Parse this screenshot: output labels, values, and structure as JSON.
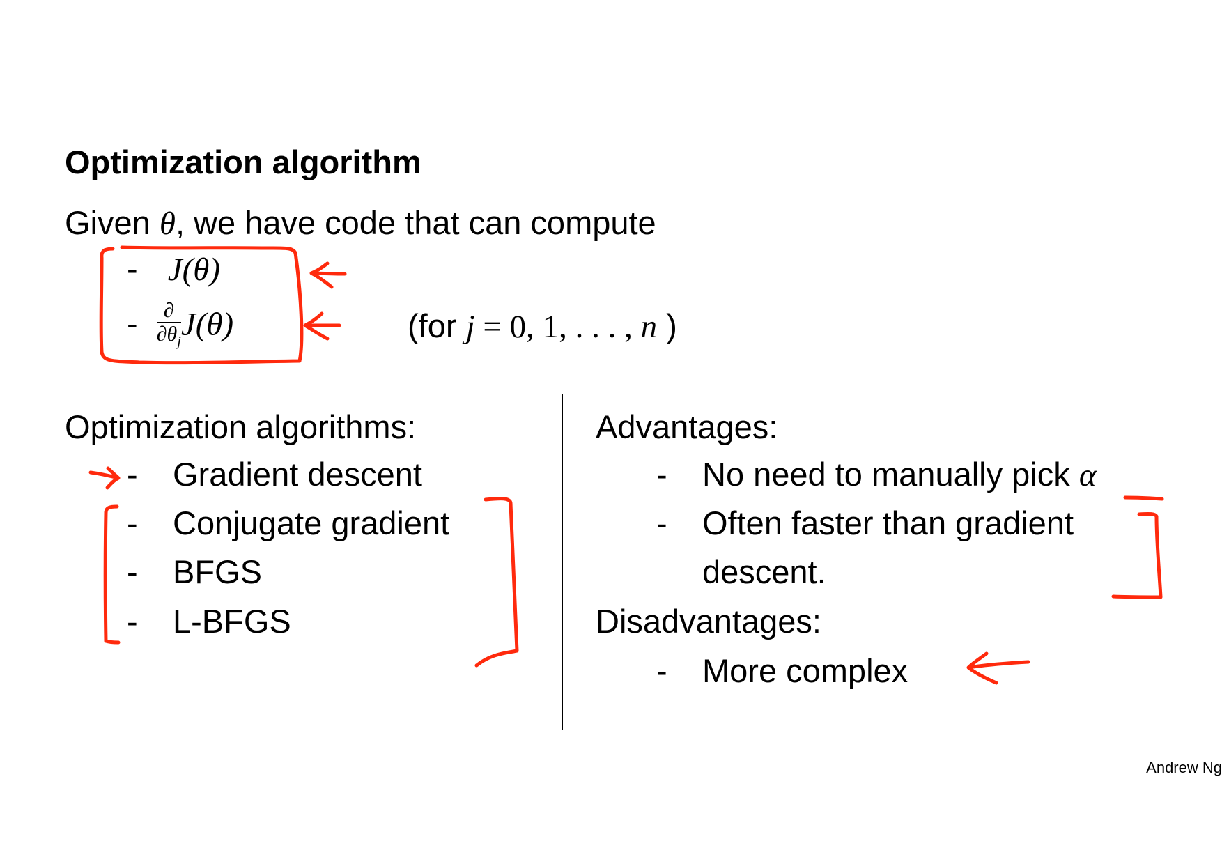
{
  "title": "Optimization algorithm",
  "given": {
    "prefix": "Given ",
    "theta": "θ",
    "suffix": ", we have code that can compute"
  },
  "compute_items": {
    "item1": {
      "dash": "-",
      "expr": "J(θ)"
    },
    "item2": {
      "dash": "-",
      "frac_num": "∂",
      "frac_den": "∂θ",
      "frac_sub": "j",
      "expr": "J(θ)"
    }
  },
  "range_note": {
    "open": "(for ",
    "var": "j",
    "eq": " = 0, 1, . . . , ",
    "n": "n",
    "close": " )"
  },
  "algorithms": {
    "heading": "Optimization algorithms:",
    "items": [
      {
        "dash": "-",
        "label": "Gradient descent"
      },
      {
        "dash": "-",
        "label": "Conjugate gradient"
      },
      {
        "dash": "-",
        "label": "BFGS"
      },
      {
        "dash": "-",
        "label": "L-BFGS"
      }
    ]
  },
  "advantages": {
    "heading": "Advantages:",
    "item1": {
      "dash": "-",
      "label": "No need to manually pick ",
      "alpha": "α"
    },
    "item2": {
      "dash": "-",
      "line1": "Often faster than gradient",
      "line2": "descent."
    }
  },
  "disadvantages": {
    "heading": "Disadvantages:",
    "item1": {
      "dash": "-",
      "label": "More complex"
    }
  },
  "footer": "Andrew Ng",
  "colors": {
    "annotation": "#ff2a0d",
    "text": "#000000",
    "background": "#ffffff"
  }
}
